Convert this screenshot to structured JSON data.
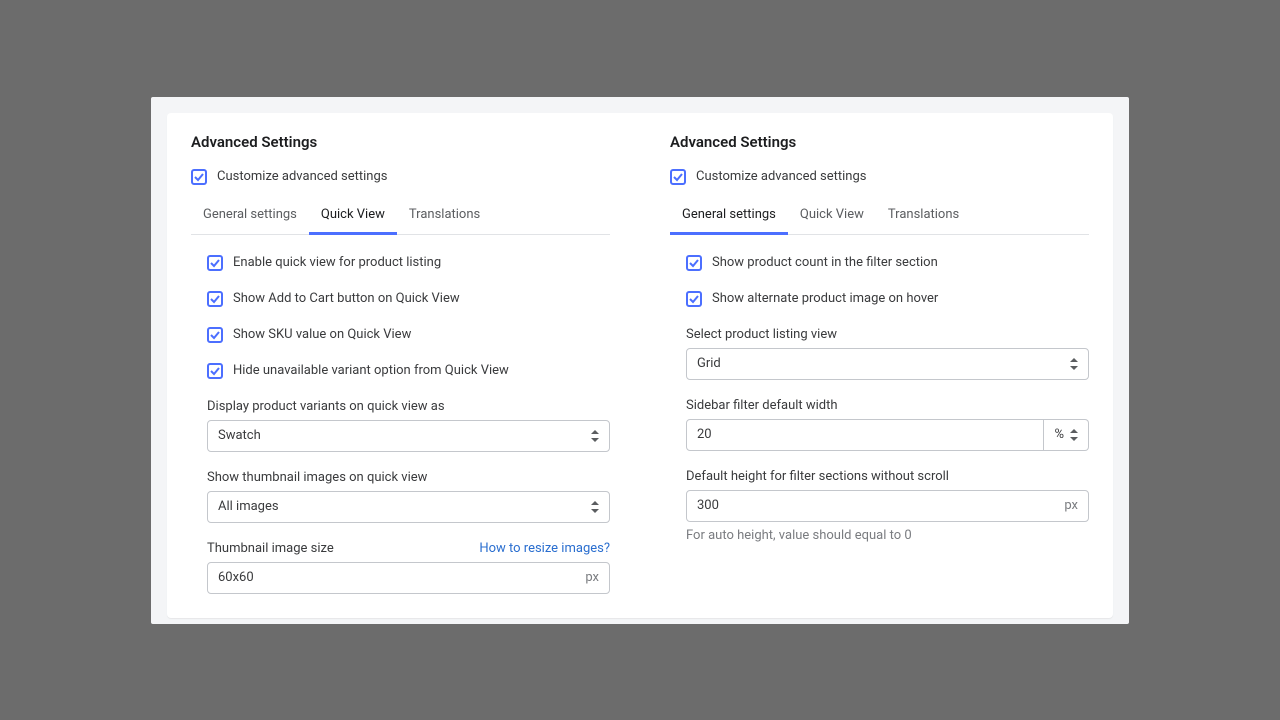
{
  "left": {
    "title": "Advanced Settings",
    "customize_label": "Customize advanced settings",
    "tabs": [
      "General settings",
      "Quick View",
      "Translations"
    ],
    "active_tab": 1,
    "checkboxes": [
      "Enable quick view for product listing",
      "Show Add to Cart button on Quick View",
      "Show SKU value on Quick View",
      "Hide unavailable variant option from Quick View"
    ],
    "variants_label": "Display product variants on quick view as",
    "variants_value": "Swatch",
    "thumbnails_label": "Show thumbnail images on quick view",
    "thumbnails_value": "All images",
    "thumb_size_label": "Thumbnail image size",
    "thumb_size_link": "How to resize images?",
    "thumb_size_value": "60x60",
    "thumb_size_unit": "px"
  },
  "right": {
    "title": "Advanced Settings",
    "customize_label": "Customize advanced settings",
    "tabs": [
      "General settings",
      "Quick View",
      "Translations"
    ],
    "active_tab": 0,
    "checkboxes": [
      "Show product count in the filter section",
      "Show alternate product image on hover"
    ],
    "listing_label": "Select product listing view",
    "listing_value": "Grid",
    "sidebar_width_label": "Sidebar filter default width",
    "sidebar_width_value": "20",
    "sidebar_width_unit": "%",
    "filter_height_label": "Default height for filter sections without scroll",
    "filter_height_value": "300",
    "filter_height_unit": "px",
    "filter_height_helper": "For auto height, value should equal to 0"
  }
}
